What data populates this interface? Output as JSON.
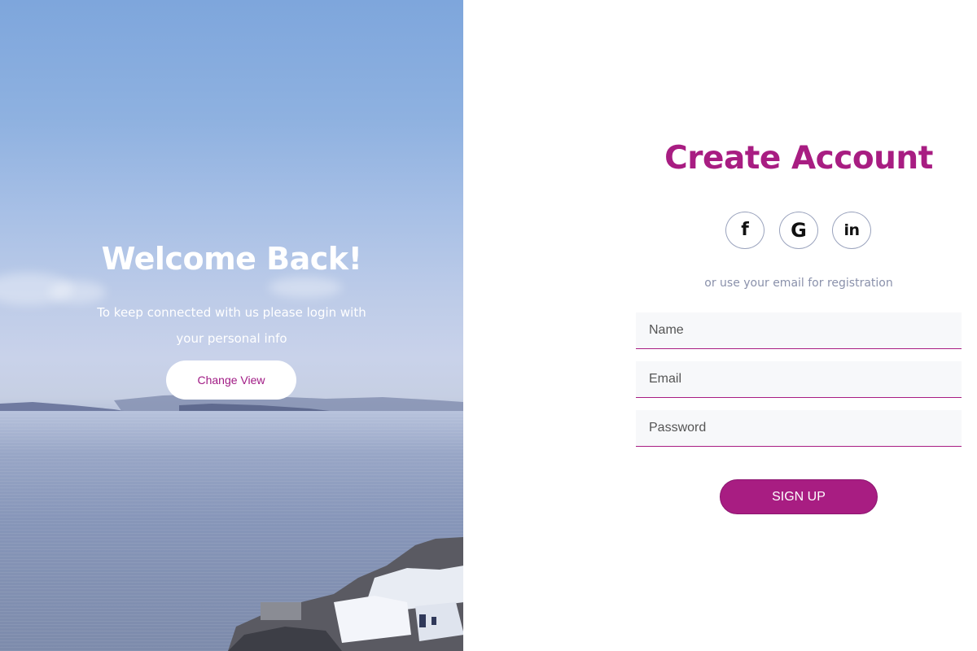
{
  "hero": {
    "title": "Welcome Back!",
    "text": "To keep connected with us please login with your personal info",
    "change_view_label": "Change View"
  },
  "form": {
    "title": "Create Account",
    "social": [
      {
        "icon": "facebook-icon",
        "glyph": "f"
      },
      {
        "icon": "google-icon",
        "glyph": "G"
      },
      {
        "icon": "linkedin-icon",
        "glyph": "in"
      }
    ],
    "hint": "or use your email for registration",
    "fields": {
      "name_placeholder": "Name",
      "email_placeholder": "Email",
      "password_placeholder": "Password"
    },
    "signup_label": "SIGN UP"
  },
  "colors": {
    "accent": "#a81d82",
    "hint_text": "#8a91ab",
    "input_bg": "#f7f8fa"
  }
}
